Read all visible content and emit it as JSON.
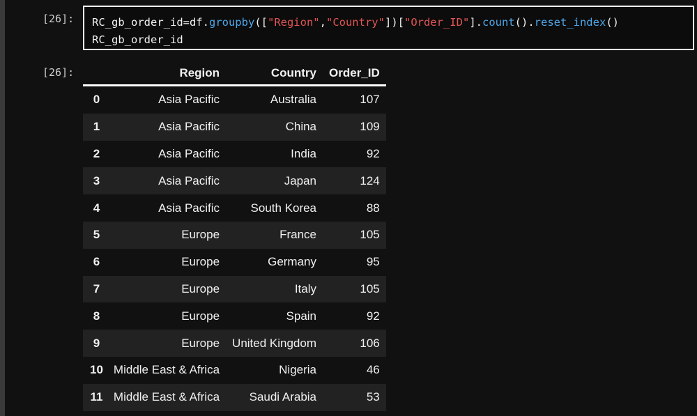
{
  "input_prompt": "[26]:",
  "output_prompt": "[26]:",
  "code": {
    "line1": [
      {
        "t": "RC_gb_order_id=df.",
        "c": "plain"
      },
      {
        "t": "groupby",
        "c": "fn"
      },
      {
        "t": "([",
        "c": "plain"
      },
      {
        "t": "\"Region\"",
        "c": "str"
      },
      {
        "t": ",",
        "c": "plain"
      },
      {
        "t": "\"Country\"",
        "c": "str"
      },
      {
        "t": "])[",
        "c": "plain"
      },
      {
        "t": "\"Order_ID\"",
        "c": "str"
      },
      {
        "t": "].",
        "c": "plain"
      },
      {
        "t": "count",
        "c": "fn"
      },
      {
        "t": "().",
        "c": "plain"
      },
      {
        "t": "reset_index",
        "c": "fn"
      },
      {
        "t": "()",
        "c": "plain"
      }
    ],
    "line2": "RC_gb_order_id"
  },
  "table": {
    "columns": [
      "",
      "Region",
      "Country",
      "Order_ID"
    ],
    "rows": [
      [
        "0",
        "Asia Pacific",
        "Australia",
        "107"
      ],
      [
        "1",
        "Asia Pacific",
        "China",
        "109"
      ],
      [
        "2",
        "Asia Pacific",
        "India",
        "92"
      ],
      [
        "3",
        "Asia Pacific",
        "Japan",
        "124"
      ],
      [
        "4",
        "Asia Pacific",
        "South Korea",
        "88"
      ],
      [
        "5",
        "Europe",
        "France",
        "105"
      ],
      [
        "6",
        "Europe",
        "Germany",
        "95"
      ],
      [
        "7",
        "Europe",
        "Italy",
        "105"
      ],
      [
        "8",
        "Europe",
        "Spain",
        "92"
      ],
      [
        "9",
        "Europe",
        "United Kingdom",
        "106"
      ],
      [
        "10",
        "Middle East & Africa",
        "Nigeria",
        "46"
      ],
      [
        "11",
        "Middle East & Africa",
        "Saudi Arabia",
        "53"
      ]
    ]
  }
}
